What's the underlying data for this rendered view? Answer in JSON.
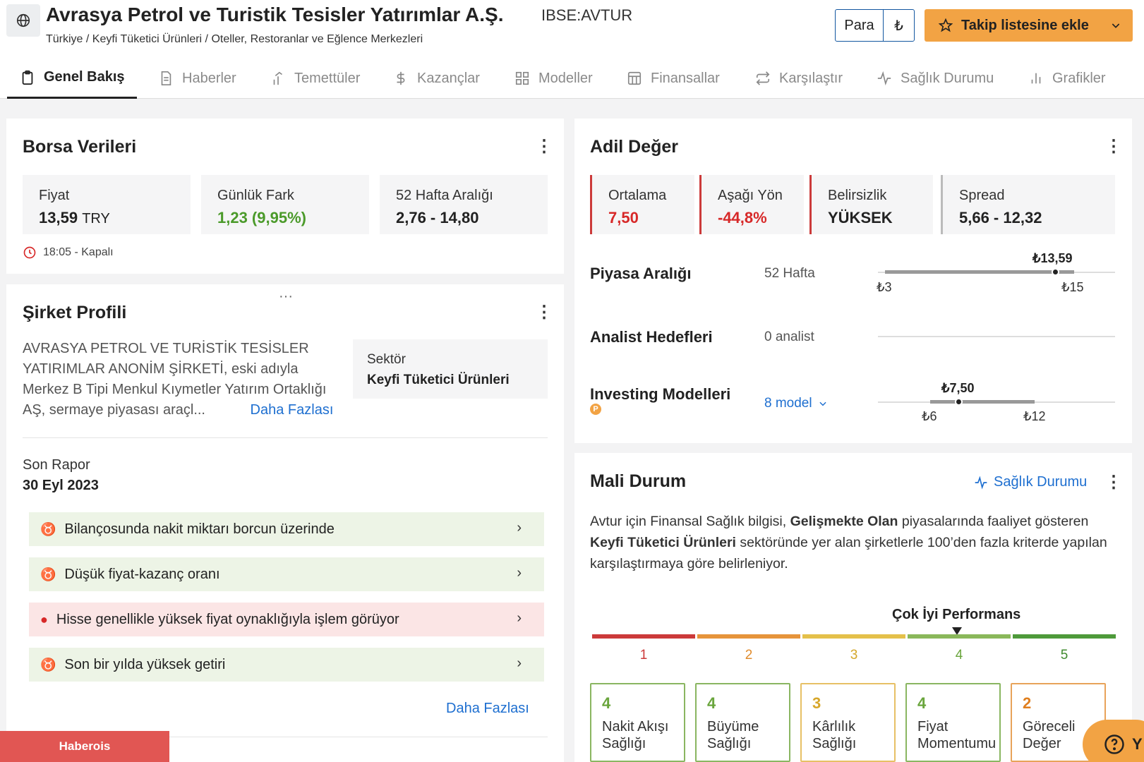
{
  "header": {
    "company": "Avrasya Petrol ve Turistik Tesisler Yatırımlar A.Ş.",
    "ticker": "IBSE:AVTUR",
    "breadcrumb": "Türkiye / Keyfi Tüketici Ürünleri / Oteller, Restoranlar ve Eğlence Merkezleri",
    "currency_label": "Para",
    "currency_symbol": "₺",
    "watchlist_label": "Takip listesine ekle"
  },
  "tabs": [
    {
      "label": "Genel Bakış",
      "icon": "clipboard-icon"
    },
    {
      "label": "Haberler",
      "icon": "document-icon"
    },
    {
      "label": "Temettüler",
      "icon": "chart-growth-icon"
    },
    {
      "label": "Kazançlar",
      "icon": "dollar-icon"
    },
    {
      "label": "Modeller",
      "icon": "grid-icon"
    },
    {
      "label": "Finansallar",
      "icon": "table-icon"
    },
    {
      "label": "Karşılaştır",
      "icon": "swap-icon"
    },
    {
      "label": "Sağlık Durumu",
      "icon": "pulse-icon"
    },
    {
      "label": "Grafikler",
      "icon": "bar-chart-icon"
    }
  ],
  "market": {
    "title": "Borsa Verileri",
    "price_label": "Fiyat",
    "price_value": "13,59",
    "price_unit": "TRY",
    "change_label": "Günlük Fark",
    "change_value": "1,23 (9,95%)",
    "range_label": "52 Hafta Aralığı",
    "range_value": "2,76 - 14,80",
    "status": "18:05 - Kapalı"
  },
  "profile": {
    "title": "Şirket Profili",
    "dots": "···",
    "description": "AVRASYA PETROL VE TURİSTİK TESİSLER YATIRIMLAR ANONİM ŞİRKETİ, eski adıyla Merkez B Tipi Menkul Kıymetler Yatırım Ortaklığı AŞ, sermaye piyasası araçl...",
    "more_label": "Daha Fazlası",
    "sector_label": "Sektör",
    "sector_value": "Keyfi Tüketici Ürünleri",
    "report_label": "Son Rapor",
    "report_date": "30 Eyl 2023",
    "insights": [
      {
        "text": "Bilançosunda nakit miktarı borcun üzerinde",
        "type": "good"
      },
      {
        "text": "Düşük fiyat-kazanç oranı",
        "type": "good"
      },
      {
        "text": "Hisse genellikle yüksek fiyat oynaklığıyla işlem görüyor",
        "type": "bad"
      },
      {
        "text": "Son bir yılda yüksek getiri",
        "type": "good"
      }
    ],
    "more_bottom": "Daha Fazlası"
  },
  "fair_value": {
    "title": "Adil Değer",
    "average_label": "Ortalama",
    "average_value": "7,50",
    "downside_label": "Aşağı Yön",
    "downside_value": "-44,8%",
    "uncertainty_label": "Belirsizlik",
    "uncertainty_value": "YÜKSEK",
    "spread_label": "Spread",
    "spread_value": "5,66 - 12,32",
    "market_range_label": "Piyasa Aralığı",
    "market_range_period": "52 Hafta",
    "market_range_current": "₺13,59",
    "market_range_low": "₺3",
    "market_range_high": "₺15",
    "analyst_label": "Analist Hedefleri",
    "analyst_count": "0 analist",
    "models_label": "Investing Modelleri",
    "models_count": "8 model",
    "models_current": "₺7,50",
    "models_low": "₺6",
    "models_high": "₺12"
  },
  "health": {
    "title": "Mali Durum",
    "link_label": "Sağlık Durumu",
    "desc_1": "Avtur için Finansal Sağlık bilgisi, ",
    "desc_bold_1": "Gelişmekte Olan",
    "desc_2": " piyasalarında faaliyet gösteren ",
    "desc_bold_2": "Keyfi Tüketici Ürünleri",
    "desc_3": " sektöründe yer alan şirketlerle 100’den fazla kriterde yapılan karşılaştırmaya göre belirleniyor.",
    "performance_label": "Çok İyi Performans",
    "scale": [
      "1",
      "2",
      "3",
      "4",
      "5"
    ],
    "scores": [
      {
        "value": "4",
        "label": "Nakit Akışı Sağlığı"
      },
      {
        "value": "4",
        "label": "Büyüme Sağlığı"
      },
      {
        "value": "3",
        "label": "Kârlılık Sağlığı"
      },
      {
        "value": "4",
        "label": "Fiyat Momentumu"
      },
      {
        "value": "2",
        "label": "Göreceli Değer"
      }
    ]
  },
  "banner": "Haberois",
  "help_label": "Y"
}
